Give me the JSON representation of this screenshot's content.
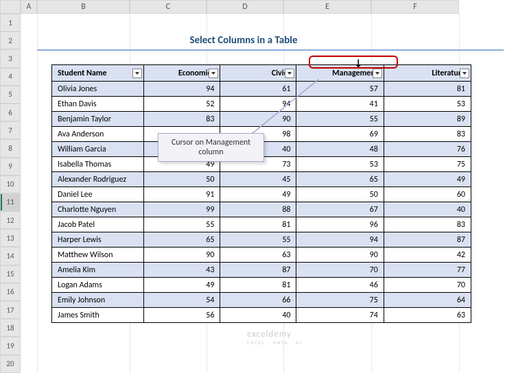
{
  "columns": [
    "A",
    "B",
    "C",
    "D",
    "E",
    "F"
  ],
  "row_numbers": [
    1,
    2,
    3,
    4,
    5,
    6,
    7,
    8,
    9,
    10,
    11,
    12,
    13,
    14,
    15,
    16,
    17,
    18,
    19,
    20
  ],
  "selected_row": 11,
  "title": "Select Columns in a Table",
  "callout_text": "Cursor on Management column",
  "watermark": {
    "main": "exceldemy",
    "sub": "EXCEL · DATA · BI"
  },
  "table": {
    "headers": [
      "Student Name",
      "Economics",
      "Civics",
      "Management",
      "Literature"
    ],
    "rows": [
      [
        "Olivia Jones",
        94,
        61,
        57,
        81
      ],
      [
        "Ethan Davis",
        52,
        94,
        41,
        53
      ],
      [
        "Benjamin Taylor",
        83,
        90,
        55,
        89
      ],
      [
        "Ava Anderson",
        "",
        98,
        69,
        83
      ],
      [
        "William Garcia",
        "",
        40,
        48,
        76
      ],
      [
        "Isabella Thomas",
        49,
        73,
        53,
        75
      ],
      [
        "Alexander Rodriguez",
        50,
        45,
        65,
        49
      ],
      [
        "Daniel Lee",
        91,
        49,
        50,
        60
      ],
      [
        "Charlotte Nguyen",
        99,
        88,
        67,
        40
      ],
      [
        "Jacob Patel",
        55,
        81,
        96,
        83
      ],
      [
        "Harper Lewis",
        65,
        55,
        94,
        87
      ],
      [
        "Matthew Wilson",
        90,
        63,
        90,
        42
      ],
      [
        "Amelia Kim",
        43,
        87,
        70,
        77
      ],
      [
        "Logan Adams",
        49,
        81,
        46,
        70
      ],
      [
        "Emily Johnson",
        54,
        66,
        75,
        64
      ],
      [
        "James Smith",
        56,
        40,
        74,
        63
      ]
    ]
  },
  "chart_data": {
    "type": "table",
    "title": "Select Columns in a Table",
    "columns": [
      "Student Name",
      "Economics",
      "Civics",
      "Management",
      "Literature"
    ],
    "data": [
      {
        "Student Name": "Olivia Jones",
        "Economics": 94,
        "Civics": 61,
        "Management": 57,
        "Literature": 81
      },
      {
        "Student Name": "Ethan Davis",
        "Economics": 52,
        "Civics": 94,
        "Management": 41,
        "Literature": 53
      },
      {
        "Student Name": "Benjamin Taylor",
        "Economics": 83,
        "Civics": 90,
        "Management": 55,
        "Literature": 89
      },
      {
        "Student Name": "Ava Anderson",
        "Economics": null,
        "Civics": 98,
        "Management": 69,
        "Literature": 83
      },
      {
        "Student Name": "William Garcia",
        "Economics": null,
        "Civics": 40,
        "Management": 48,
        "Literature": 76
      },
      {
        "Student Name": "Isabella Thomas",
        "Economics": 49,
        "Civics": 73,
        "Management": 53,
        "Literature": 75
      },
      {
        "Student Name": "Alexander Rodriguez",
        "Economics": 50,
        "Civics": 45,
        "Management": 65,
        "Literature": 49
      },
      {
        "Student Name": "Daniel Lee",
        "Economics": 91,
        "Civics": 49,
        "Management": 50,
        "Literature": 60
      },
      {
        "Student Name": "Charlotte Nguyen",
        "Economics": 99,
        "Civics": 88,
        "Management": 67,
        "Literature": 40
      },
      {
        "Student Name": "Jacob Patel",
        "Economics": 55,
        "Civics": 81,
        "Management": 96,
        "Literature": 83
      },
      {
        "Student Name": "Harper Lewis",
        "Economics": 65,
        "Civics": 55,
        "Management": 94,
        "Literature": 87
      },
      {
        "Student Name": "Matthew Wilson",
        "Economics": 90,
        "Civics": 63,
        "Management": 90,
        "Literature": 42
      },
      {
        "Student Name": "Amelia Kim",
        "Economics": 43,
        "Civics": 87,
        "Management": 70,
        "Literature": 77
      },
      {
        "Student Name": "Logan Adams",
        "Economics": 49,
        "Civics": 81,
        "Management": 46,
        "Literature": 70
      },
      {
        "Student Name": "Emily Johnson",
        "Economics": 54,
        "Civics": 66,
        "Management": 75,
        "Literature": 64
      },
      {
        "Student Name": "James Smith",
        "Economics": 56,
        "Civics": 40,
        "Management": 74,
        "Literature": 63
      }
    ]
  }
}
